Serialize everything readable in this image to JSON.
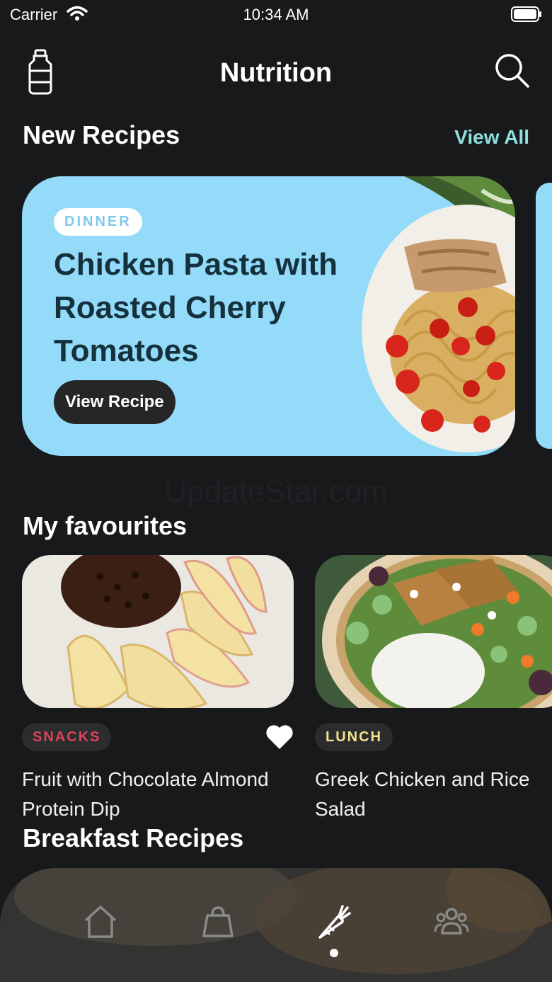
{
  "status_bar": {
    "carrier": "Carrier",
    "time": "10:34 AM"
  },
  "header": {
    "title": "Nutrition",
    "left_icon": "water-bottle-icon",
    "right_icon": "search-icon"
  },
  "new_recipes": {
    "title": "New Recipes",
    "view_all_label": "View All",
    "featured": {
      "category": "DINNER",
      "title": "Chicken Pasta with Roasted Cherry Tomatoes",
      "button_label": "View Recipe",
      "background_color": "#93dbf8"
    }
  },
  "watermark": "UpdateStar.com",
  "favourites": {
    "title": "My favourites",
    "items": [
      {
        "category": "SNACKS",
        "category_color": "#e0425a",
        "title": "Fruit with Chocolate Almond Protein Dip",
        "favorited": true
      },
      {
        "category": "LUNCH",
        "category_color": "#f4e38b",
        "title": "Greek Chicken and Rice Salad",
        "favorited": false
      }
    ]
  },
  "breakfast": {
    "title": "Breakfast Recipes"
  },
  "tab_bar": {
    "tabs": [
      {
        "icon": "home-icon",
        "active": false
      },
      {
        "icon": "shopping-bag-icon",
        "active": false
      },
      {
        "icon": "carrot-icon",
        "active": true
      },
      {
        "icon": "community-icon",
        "active": false
      }
    ]
  },
  "colors": {
    "accent": "#8de0dc",
    "background": "#18191b"
  }
}
